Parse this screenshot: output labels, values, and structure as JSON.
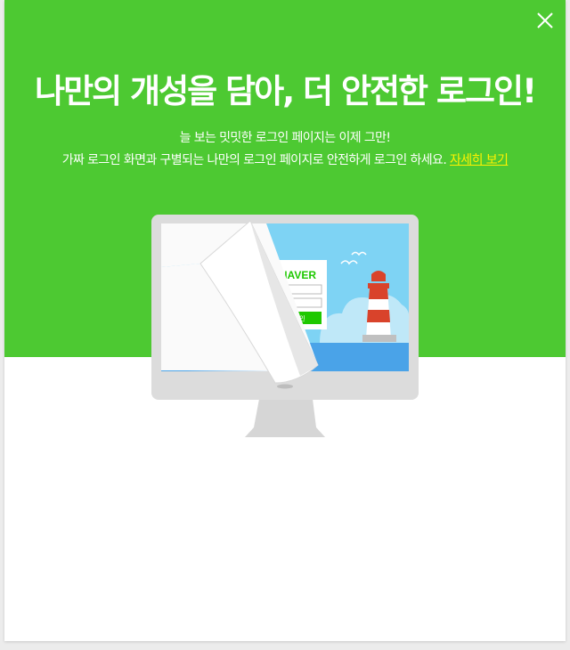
{
  "headline": "나만의 개성을 담아, 더 안전한 로그인!",
  "subtitle_line1": "늘 보는 밋밋한 로그인 페이지는 이제 그만!",
  "subtitle_line2": "가짜 로그인 화면과 구별되는 나만의 로그인 페이지로 안전하게 로그인 하세요.",
  "detail_link": "자세히 보기",
  "illustration": {
    "brand": "NAVER",
    "login_button": "로그인",
    "icons": [
      "close-icon",
      "monitor",
      "lighthouse",
      "seagulls",
      "page-curl"
    ]
  },
  "colors": {
    "hero_green": "#4dc932",
    "link_yellow": "#fff200",
    "naver_green": "#1ec800",
    "sky_blue": "#7ed3f4",
    "sea_blue": "#4aa3e8",
    "lighthouse_red": "#d9432b"
  }
}
